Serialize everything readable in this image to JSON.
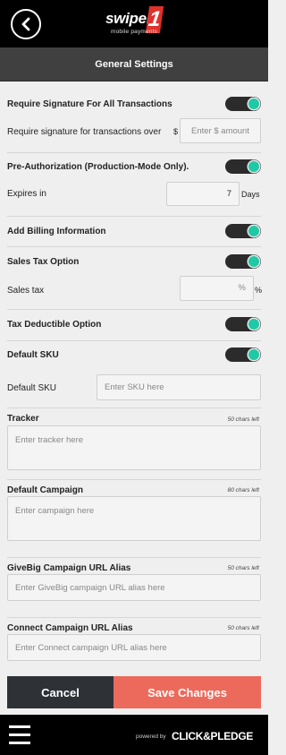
{
  "header": {
    "logo_text": "swiper",
    "logo_number": "1",
    "logo_tagline": "mobile payments"
  },
  "title": "General Settings",
  "signature": {
    "label": "Require Signature For All Transactions",
    "enabled": true,
    "over_label": "Require signature for transactions over",
    "currency": "$",
    "amount_placeholder": "Enter $ amount"
  },
  "preauth": {
    "label": "Pre-Authorization (Production-Mode Only).",
    "enabled": true,
    "expires_label": "Expires in",
    "expires_value": "7",
    "expires_unit": "Days"
  },
  "billing": {
    "label": "Add Billing Information",
    "enabled": true
  },
  "sales_tax": {
    "label": "Sales Tax Option",
    "enabled": true,
    "field_label": "Sales tax",
    "suffix_inside": "%",
    "suffix_outside": "%"
  },
  "tax_deductible": {
    "label": "Tax Deductible Option",
    "enabled": true
  },
  "sku": {
    "label": "Default SKU",
    "enabled": true,
    "field_label": "Default SKU",
    "placeholder": "Enter SKU here"
  },
  "tracker": {
    "label": "Tracker",
    "chars_left": "50 chars left",
    "placeholder": "Enter tracker here"
  },
  "campaign": {
    "label": "Default Campaign",
    "chars_left": "80 chars left",
    "placeholder": "Enter campaign here"
  },
  "givebig": {
    "label": "GiveBig Campaign URL Alias",
    "chars_left": "50 chars left",
    "placeholder": "Enter GiveBig campaign URL alias here"
  },
  "connect": {
    "label": "Connect Campaign URL Alias",
    "chars_left": "50 chars left",
    "placeholder": "Enter Connect campaign URL alias here"
  },
  "buttons": {
    "cancel": "Cancel",
    "save": "Save Changes"
  },
  "footer": {
    "powered_by": "powered by",
    "brand": "CLICK&PLEDGE"
  },
  "colors": {
    "toggle_on": "#1fc9a6",
    "save": "#ec6a5b",
    "cancel": "#2e3236",
    "header": "#000000"
  }
}
